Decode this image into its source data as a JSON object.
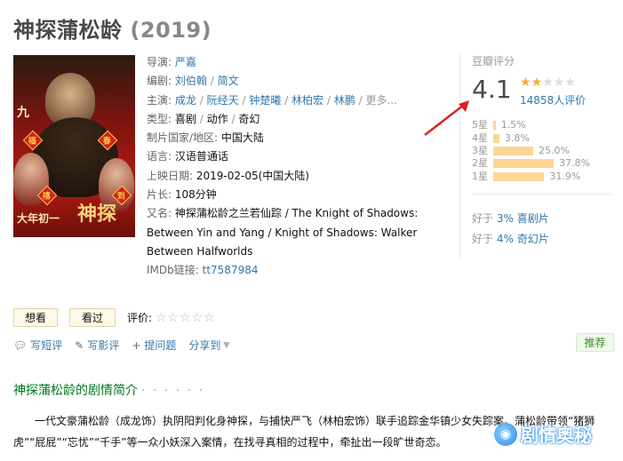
{
  "title": {
    "name": "神探蒲松龄",
    "year": "(2019)"
  },
  "poster": {
    "alt": "神探蒲松龄 poster",
    "text_top": "九",
    "text_left": "大年初一",
    "badges": [
      "福",
      "春",
      "禧",
      "到"
    ]
  },
  "info": {
    "director_label": "导演:",
    "director": "严嘉",
    "writer_label": "编剧:",
    "writers": [
      "刘伯翰",
      "简文"
    ],
    "cast_label": "主演:",
    "cast": [
      "成龙",
      "阮经天",
      "钟楚曦",
      "林柏宏",
      "林鹏"
    ],
    "cast_more": "更多...",
    "genre_label": "类型:",
    "genres": [
      "喜剧",
      "动作",
      "奇幻"
    ],
    "country_label": "制片国家/地区:",
    "country": "中国大陆",
    "language_label": "语言:",
    "language": "汉语普通话",
    "release_label": "上映日期:",
    "release": "2019-02-05(中国大陆)",
    "runtime_label": "片长:",
    "runtime": "108分钟",
    "aka_label": "又名:",
    "aka": "神探蒲松龄之兰若仙踪 / The Knight of Shadows: Between Yin and Yang / Knight of Shadows: Walker Between Halfworlds",
    "imdb_label": "IMDb链接:",
    "imdb": "tt7587984"
  },
  "rating": {
    "header": "豆瓣评分",
    "score": "4.1",
    "stars_value": 2.0,
    "votes": "14858人评价",
    "distribution": [
      {
        "label": "5星",
        "percent": 1.5,
        "text": "1.5%"
      },
      {
        "label": "4星",
        "percent": 3.8,
        "text": "3.8%"
      },
      {
        "label": "3星",
        "percent": 25.0,
        "text": "25.0%"
      },
      {
        "label": "2星",
        "percent": 37.8,
        "text": "37.8%"
      },
      {
        "label": "1星",
        "percent": 31.9,
        "text": "31.9%"
      }
    ],
    "better_than": [
      {
        "prefix": "好于 ",
        "pct": "3%",
        "genre": "喜剧片"
      },
      {
        "prefix": "好于 ",
        "pct": "4%",
        "genre": "奇幻片"
      }
    ]
  },
  "actions": {
    "want": "想看",
    "seen": "看过",
    "rate_label": "评价:",
    "write_short": "写短评",
    "write_review": "写影评",
    "ask": "提问题",
    "share": "分享到",
    "recommend": "推荐"
  },
  "synopsis": {
    "heading": "神探蒲松龄的剧情简介",
    "dots": "· · · · · ·",
    "text": "一代文豪蒲松龄（成龙饰）执阴阳判化身神探，与捕快严飞（林柏宏饰）联手追踪金华镇少女失踪案。蒲松龄带领“猪狮虎”“屁屁”“忘忧”“千手”等一众小妖深入案情，在找寻真相的过程中，牵扯出一段旷世奇恋。"
  },
  "watermark": {
    "text": "剧情奥秘"
  },
  "colors": {
    "link": "#3377aa",
    "star": "#ffac2d",
    "bar": "#ffd596",
    "green": "#007722",
    "annotation": "#e02020"
  }
}
